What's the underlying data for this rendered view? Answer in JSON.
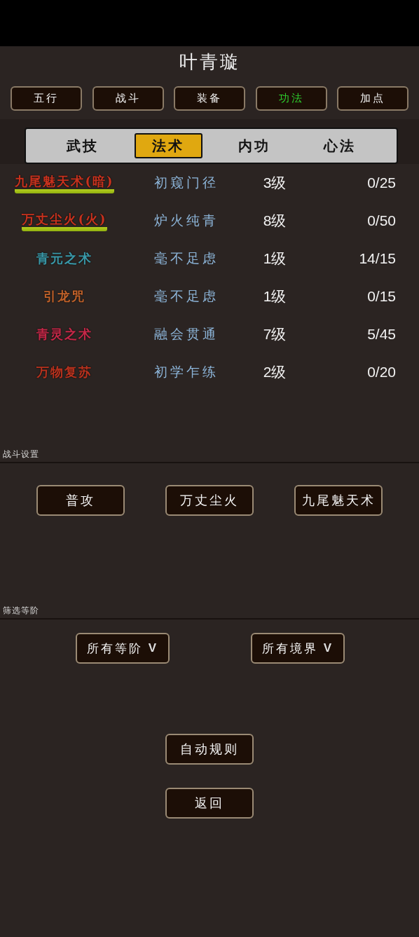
{
  "title": "叶青璇",
  "tabs": [
    {
      "label": "五行",
      "selected": false
    },
    {
      "label": "战斗",
      "selected": false
    },
    {
      "label": "装备",
      "selected": false
    },
    {
      "label": "功法",
      "selected": true
    },
    {
      "label": "加点",
      "selected": false
    }
  ],
  "subtabs": [
    {
      "label": "武技",
      "selected": false
    },
    {
      "label": "法术",
      "selected": true
    },
    {
      "label": "内功",
      "selected": false
    },
    {
      "label": "心法",
      "selected": false
    }
  ],
  "skills": [
    {
      "name": "九尾魅天术(暗)",
      "color": "#c8321e",
      "highlighted": true,
      "stage": "初窥门径",
      "level": "3级",
      "progress": "0/25"
    },
    {
      "name": "万丈尘火(火)",
      "color": "#c8321e",
      "highlighted": true,
      "stage": "炉火纯青",
      "level": "8级",
      "progress": "0/50"
    },
    {
      "name": "青元之术",
      "color": "#3a98a8",
      "highlighted": false,
      "stage": "毫不足虑",
      "level": "1级",
      "progress": "14/15"
    },
    {
      "name": "引龙咒",
      "color": "#c2622a",
      "highlighted": false,
      "stage": "毫不足虑",
      "level": "1级",
      "progress": "0/15"
    },
    {
      "name": "青灵之术",
      "color": "#c42848",
      "highlighted": false,
      "stage": "融会贯通",
      "level": "7级",
      "progress": "5/45"
    },
    {
      "name": "万物复苏",
      "color": "#b8321e",
      "highlighted": false,
      "stage": "初学乍练",
      "level": "2级",
      "progress": "0/20"
    }
  ],
  "battle_settings": {
    "label": "战斗设置",
    "buttons": [
      "普攻",
      "万丈尘火",
      "九尾魅天术"
    ]
  },
  "filter": {
    "label": "筛选等阶",
    "dropdowns": [
      {
        "value": "所有等阶",
        "caret": "V"
      },
      {
        "value": "所有境界",
        "caret": "V"
      }
    ]
  },
  "buttons": [
    "自动规则",
    "返回"
  ]
}
